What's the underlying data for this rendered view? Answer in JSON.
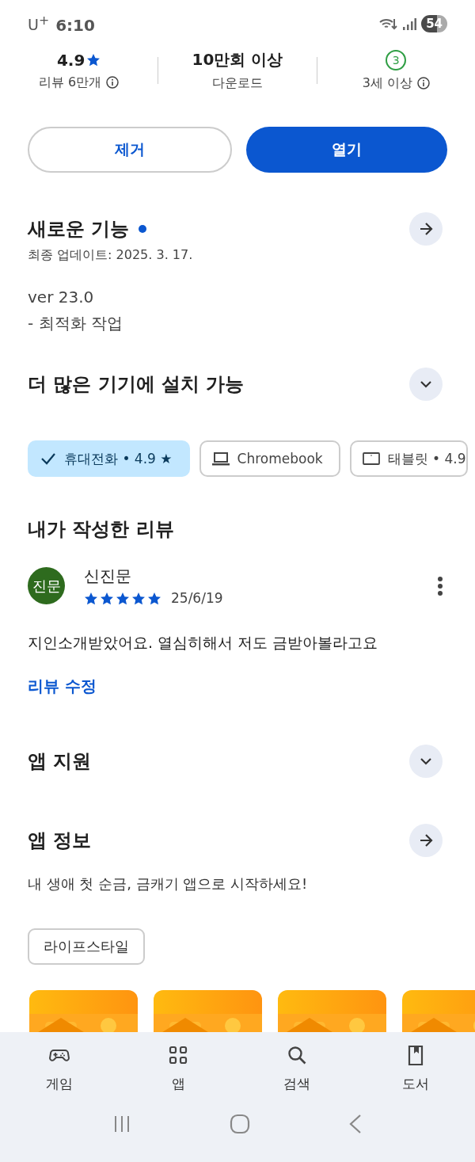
{
  "status_bar": {
    "carrier": "U$^{+}$",
    "time": "6:10",
    "battery": "54"
  },
  "stats": [
    {
      "kind": "rating",
      "value": "4.9",
      "label": "리뷰 6만개",
      "info": true
    },
    {
      "kind": "count",
      "value": "10만회 이상",
      "label": "다운로드",
      "info": false
    },
    {
      "kind": "age",
      "value": "3",
      "label": "3세 이상",
      "info": true
    }
  ],
  "buttons": [
    {
      "kind": "outlined",
      "label": "제거"
    },
    {
      "kind": "filled",
      "label": "열기"
    }
  ],
  "whats_new": {
    "title": "새로운 기능",
    "new_dot": true,
    "updated": "최종 업데이트: 2025. 3. 17.",
    "notes": [
      "ver 23.0",
      "- 최적화 작업"
    ]
  },
  "devices": {
    "title": "더 많은 기기에 설치 가능",
    "expanded": false,
    "chips": [
      {
        "label": "휴대전화 • 4.9 ★",
        "selected": true
      },
      {
        "kind": "laptop",
        "label": "Chromebook",
        "selected": false
      },
      {
        "kind": "tablet",
        "label": "태블릿 • 4.9",
        "selected": false
      }
    ]
  },
  "my_review": {
    "title": "내가 작성한 리뷰",
    "avatar": "진문",
    "author": "신진문",
    "stars": 5,
    "date": "25/6/19",
    "text": "지인소개받았어요. 열심히해서 저도 금받아볼라고요",
    "edit_link": "리뷰 수정"
  },
  "app_support": {
    "title": "앱 지원",
    "expanded": false
  },
  "app_info": {
    "title": "앱 정보",
    "description": "내 생애 첫 순금, 금캐기 앱으로 시작하세요!",
    "tags": [
      "라이프스타일"
    ]
  },
  "bottom_nav": [
    {
      "kind": "games",
      "label": "게임"
    },
    {
      "kind": "apps",
      "label": "앱"
    },
    {
      "kind": "search",
      "label": "검색"
    },
    {
      "kind": "books",
      "label": "도서"
    }
  ]
}
